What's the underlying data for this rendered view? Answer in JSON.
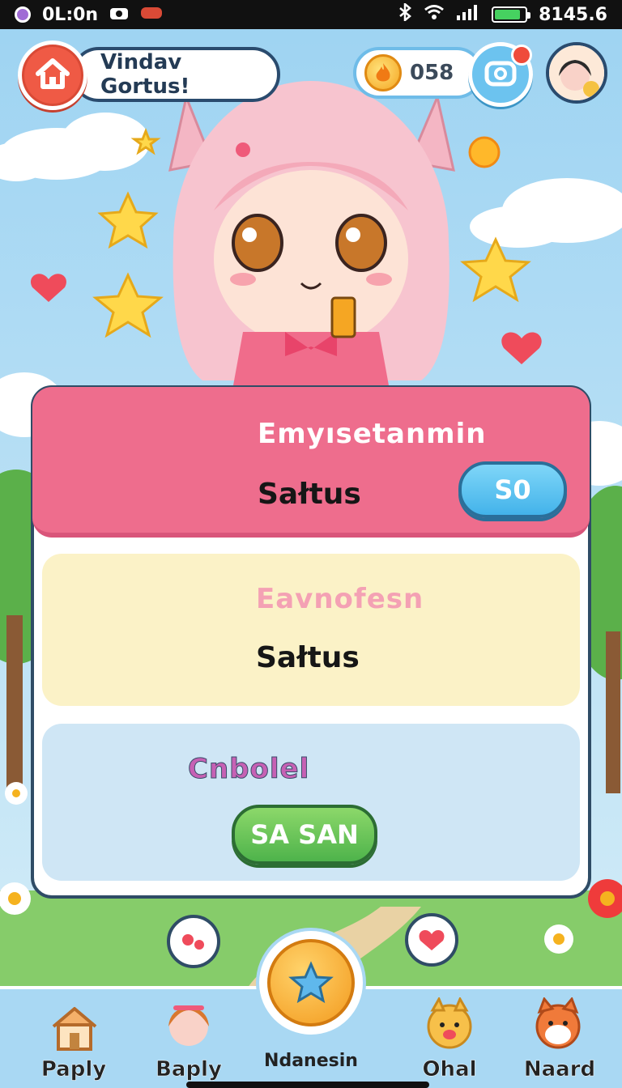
{
  "status_bar": {
    "left_text": "0L:0n",
    "right_text": "8145.6",
    "battery_level": 0.85
  },
  "header": {
    "greeting": "Vindav Gortus!",
    "coins": "058"
  },
  "cards": [
    {
      "title": "Emyısetanmin",
      "subtitle": "Sałtus",
      "button": "S0"
    },
    {
      "title": "Eavnofesn",
      "subtitle": "Sałtus"
    },
    {
      "title": "Cnbolel",
      "button": "SA SAN"
    }
  ],
  "bottom_nav": {
    "items": [
      {
        "label": "Paply",
        "icon": "house-icon"
      },
      {
        "label": "Baply",
        "icon": "girl-face-icon"
      },
      {
        "label": "Ndanesin",
        "icon": "star-chat-icon"
      },
      {
        "label": "Ohal",
        "icon": "dog-face-icon"
      },
      {
        "label": "Naard",
        "icon": "fox-face-icon"
      }
    ]
  },
  "colors": {
    "card1": "#ee6d8d",
    "card2": "#fbf2c7",
    "card3": "#cfe6f5",
    "accent_blue": "#43b3ea",
    "accent_green": "#4eb34b",
    "home_red": "#ef5a45"
  }
}
